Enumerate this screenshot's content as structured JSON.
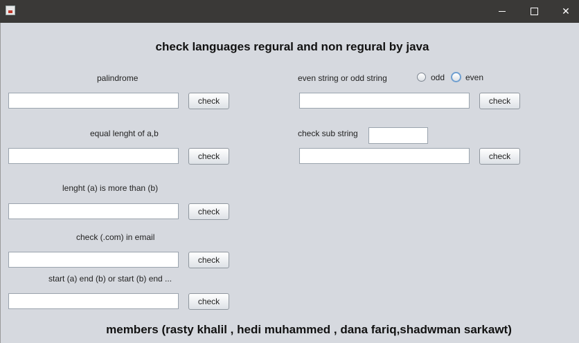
{
  "window": {
    "title": ""
  },
  "heading": "check languages regural and non regural by java",
  "sections": {
    "palindrome": {
      "label": "palindrome",
      "value": "",
      "button": "check"
    },
    "equal_length": {
      "label": "equal lenght of a,b",
      "value": "",
      "button": "check"
    },
    "more_a": {
      "label": "lenght (a) is more than (b)",
      "value": "",
      "button": "check"
    },
    "email": {
      "label": "check (.com) in email",
      "value": "",
      "button": "check"
    },
    "start_end": {
      "label": "start (a) end (b) or start (b) end ...",
      "value": "",
      "button": "check"
    },
    "even_odd": {
      "label": "even string or odd  string",
      "value": "",
      "button": "check",
      "options": [
        "odd",
        "even"
      ],
      "selected": "none"
    },
    "substring": {
      "label": "check sub string",
      "substring_value": "",
      "value": "",
      "button": "check"
    }
  },
  "members": "members (rasty khalil , hedi muhammed , dana fariq,shadwman sarkawt)"
}
